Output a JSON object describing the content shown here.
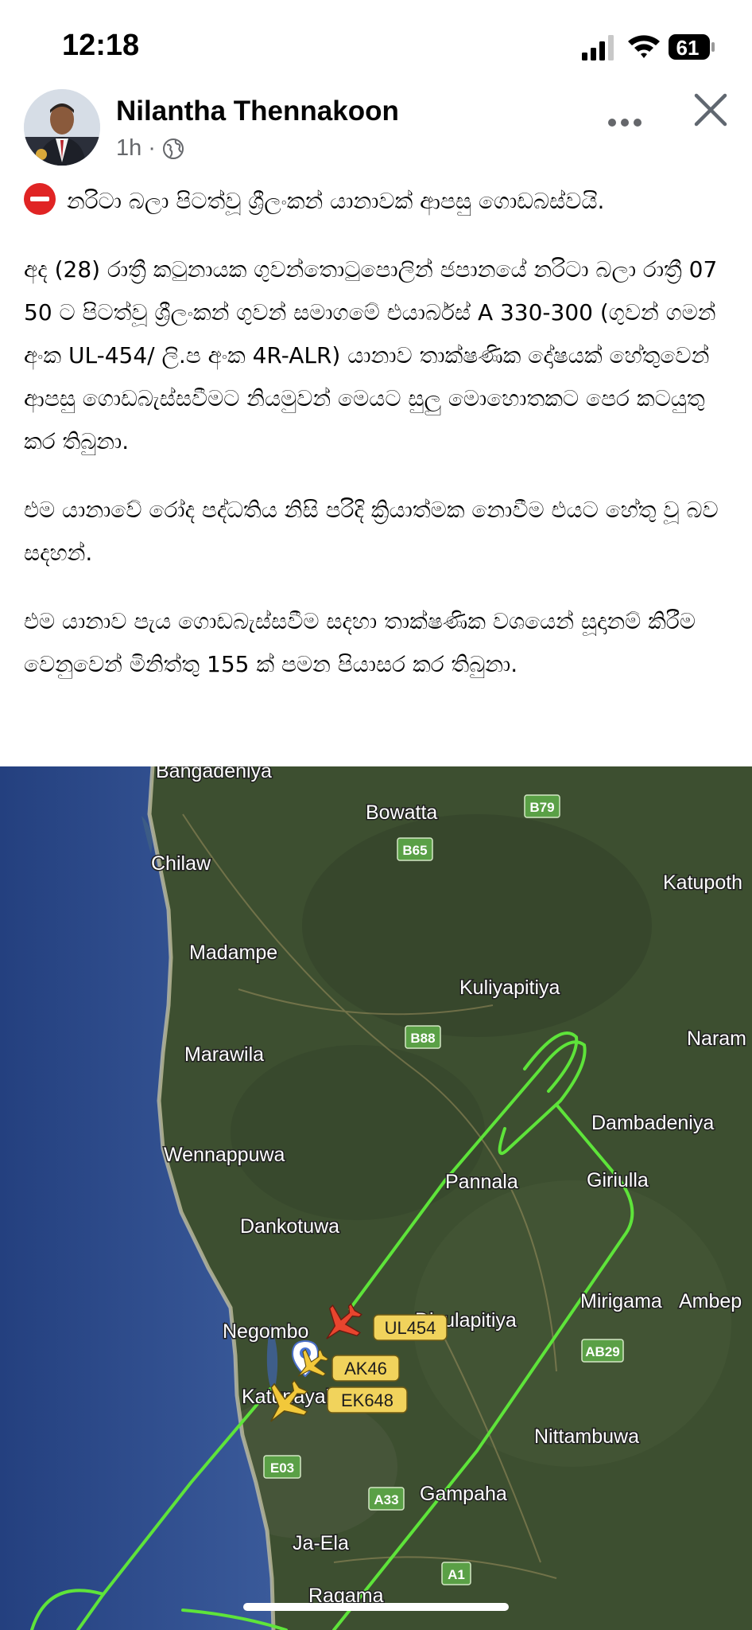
{
  "status_bar": {
    "time": "12:18",
    "battery_level": "61"
  },
  "post": {
    "author_name": "Nilantha Thennakoon",
    "timestamp": "1h",
    "separator": "·",
    "privacy_icon": "globe-icon",
    "paragraphs": [
      "නරිටා බලා පිටත්වූ ශ්‍රීලංකන් යානාවක් ආපසු ගොඩබස්වයි.",
      "අද (28) රාත්‍රී කටුනායක ගුවන්තොටුපොලින් ජපානයේ නරිටා බලා රාත්‍රී 07 50 ට පිටත්වූ ශ්‍රීලංකන් ගුවන් සමාගමේ එයාර්බස් A 330-300 (ගුවන් ගමන් අංක UL-454/ ලි.ප අංක 4R-ALR) යානාව තාක්ෂණික දෝෂයක් හේතුවෙන් ආපසු ගොඩබැස්සවීමට නියමුවන් මෙයට සුලු මොහොතකට පෙර කටයුතු කර තිබුනා.",
      "එම යානාවේ රෝද පද්ධතිය නිසි පරිදි ක්‍රියාත්මක නොවීම එයට හේතු වූ බව සදහන්.",
      "එම යානාව පැය ගොඩබැස්සවීම සදහා තාක්ෂණික වශයෙන් සූදානම් කිරීම වෙනුවෙන්  මිනිත්තු 155 ක් පමන පියාසර කර තිබුනා."
    ]
  },
  "map": {
    "places": {
      "bangadeniya": "Bangadeniya",
      "bowatta": "Bowatta",
      "chilaw": "Chilaw",
      "katupotha": "Katupoth",
      "madampe": "Madampe",
      "kuliyapitiya": "Kuliyapitiya",
      "marawila": "Marawila",
      "naram": "Naram",
      "dambadeniya": "Dambadeniya",
      "wennappuwa": "Wennappuwa",
      "pannala": "Pannala",
      "giriulla": "Giriulla",
      "dankotuwa": "Dankotuwa",
      "mirigama": "Mirigama",
      "ambep": "Ambep",
      "negombo": "Negombo",
      "divulapitiya": "Divulapitiya",
      "katunayake": "Katunayake",
      "nittambuwa": "Nittambuwa",
      "gampaha": "Gampaha",
      "ja_ela": "Ja-Ela",
      "ragama": "Ragama"
    },
    "roads": {
      "b79": "B79",
      "b65": "B65",
      "b88": "B88",
      "ab29": "AB29",
      "e03": "E03",
      "a33": "A33",
      "a1": "A1"
    },
    "flights": {
      "ul454": "UL454",
      "ak46": "AK46",
      "ek648": "EK648"
    },
    "colors": {
      "track": "#5ee43a",
      "flight_label_bg": "#f1d35c",
      "plane_red": "#e8452e",
      "plane_yellow": "#f2c83a",
      "road_shield": "#5aa046"
    }
  }
}
